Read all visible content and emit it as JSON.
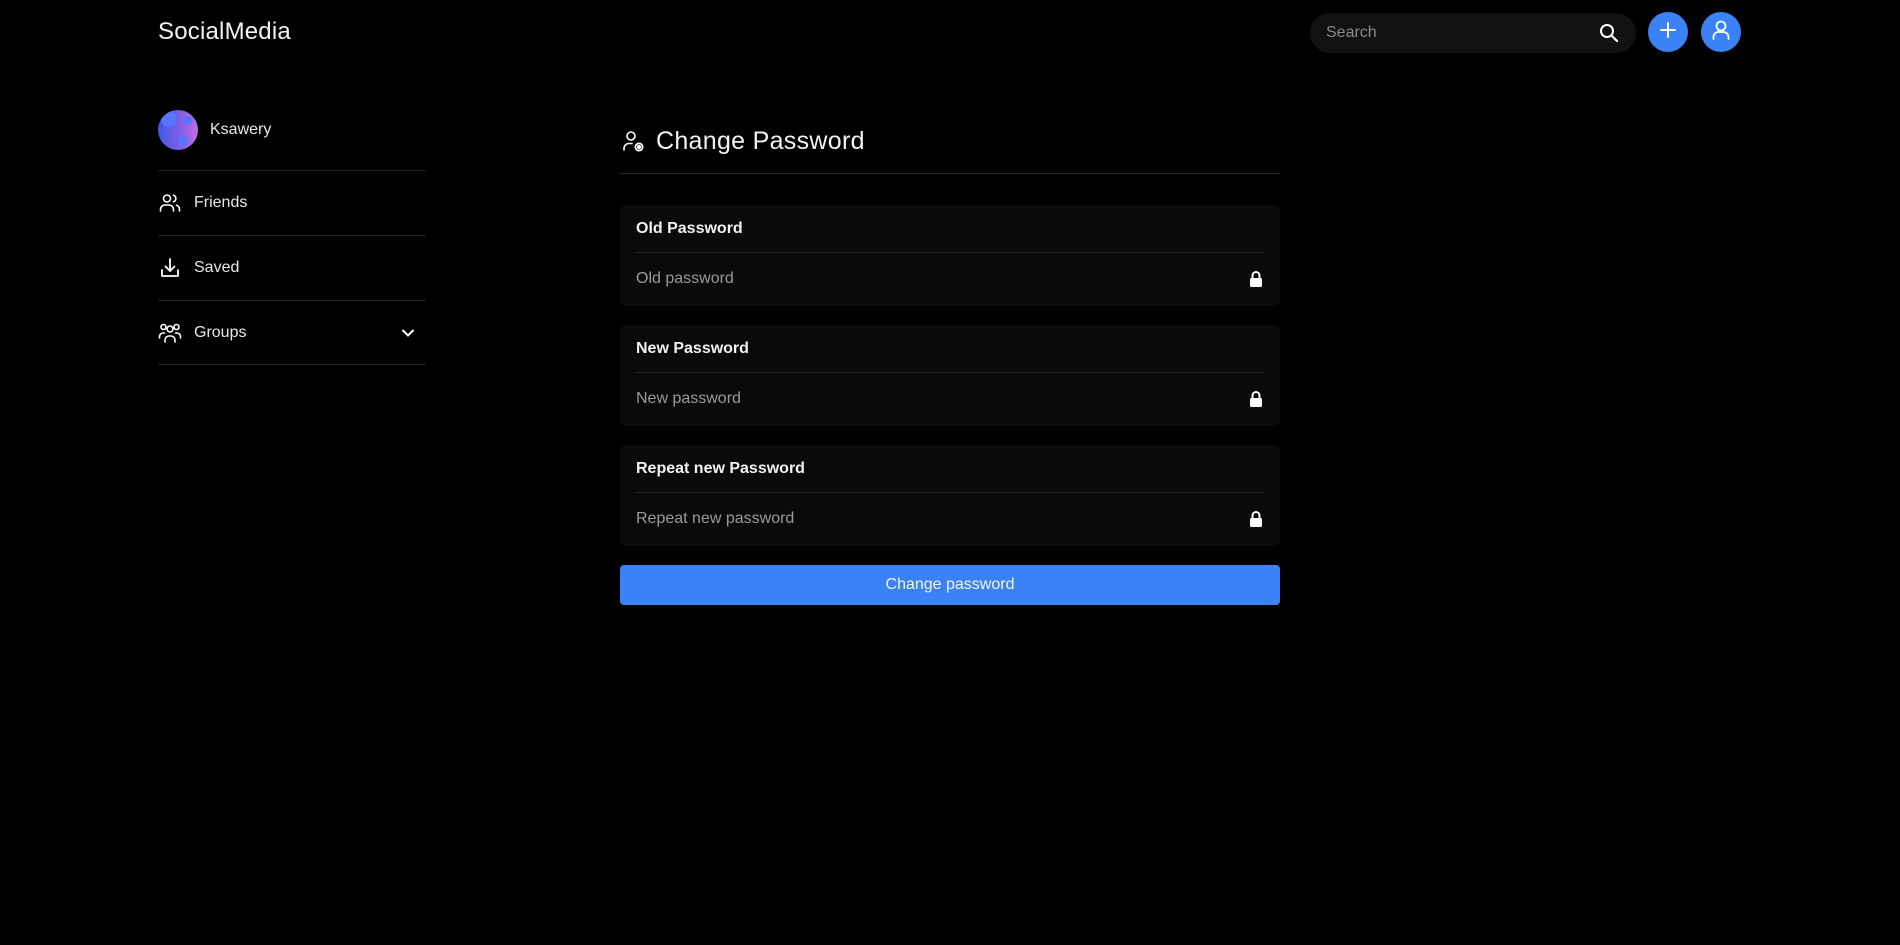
{
  "header": {
    "brand": "SocialMedia",
    "search_placeholder": "Search",
    "search_icon": "search-icon",
    "add_icon": "plus-icon",
    "profile_icon": "user-icon"
  },
  "sidebar": {
    "user": {
      "name": "Ksawery",
      "avatar": "gradient-avatar"
    },
    "items": [
      {
        "label": "Friends",
        "icon": "users-icon"
      },
      {
        "label": "Saved",
        "icon": "download-icon"
      },
      {
        "label": "Groups",
        "icon": "group-icon",
        "expandable": true
      }
    ]
  },
  "main": {
    "title": "Change Password",
    "title_icon": "user-gear-icon",
    "fields": [
      {
        "label": "Old Password",
        "placeholder": "Old password",
        "value": ""
      },
      {
        "label": "New Password",
        "placeholder": "New password",
        "value": ""
      },
      {
        "label": "Repeat new Password",
        "placeholder": "Repeat new password",
        "value": ""
      }
    ],
    "submit_label": "Change password"
  },
  "colors": {
    "accent": "#3b82f6",
    "background": "#000000",
    "card": "#0a0a0a",
    "search_bg": "#111111"
  }
}
